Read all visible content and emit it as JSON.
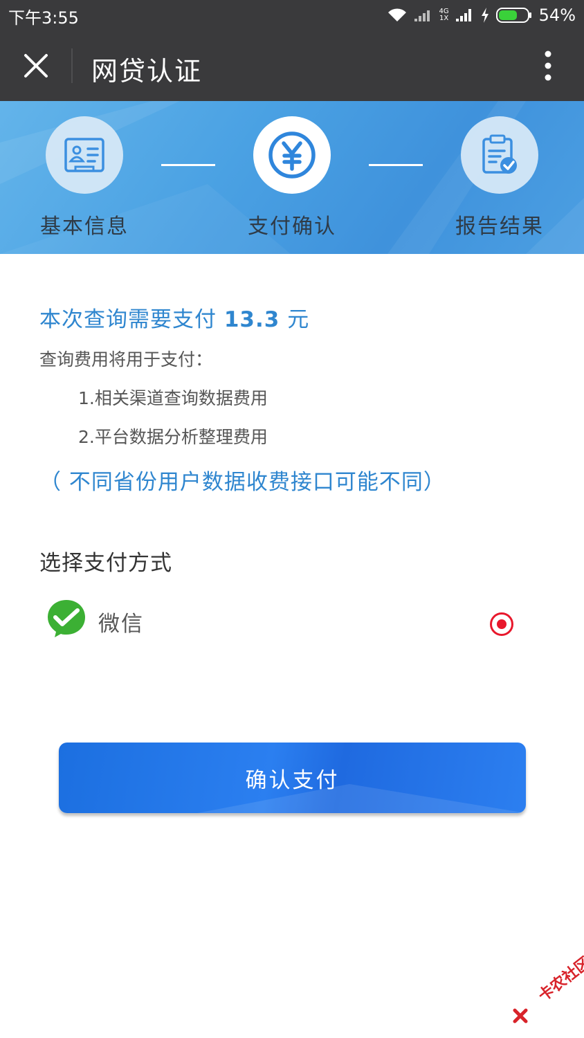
{
  "status_bar": {
    "time": "下午3:55",
    "network_top": "4G",
    "network_bottom": "1X",
    "battery": "54%"
  },
  "header": {
    "title": "网贷认证"
  },
  "steps": [
    {
      "label": "基本信息",
      "state": "done",
      "icon": "id-card-icon"
    },
    {
      "label": "支付确认",
      "state": "active",
      "icon": "yuan-icon"
    },
    {
      "label": "报告结果",
      "state": "pending",
      "icon": "clipboard-check-icon"
    }
  ],
  "payment": {
    "prefix": "本次查询需要支付",
    "amount": "13.3",
    "unit": "元",
    "fee_intro": "查询费用将用于支付：",
    "fee_items": [
      "1.相关渠道查询数据费用",
      "2.平台数据分析整理费用"
    ],
    "notice": "（ 不同省份用户数据收费接口可能不同）"
  },
  "method": {
    "section_title": "选择支付方式",
    "options": [
      {
        "label": "微信",
        "icon": "wechat-pay-icon",
        "selected": true
      }
    ]
  },
  "confirm_button": "确认支付",
  "watermark": "卡农社区",
  "colors": {
    "accent_blue": "#2f86cf",
    "button_blue": "#2277e8",
    "header_bg": "#3a3a3c",
    "radio_red": "#e8182c",
    "wechat_green": "#3cb034"
  }
}
